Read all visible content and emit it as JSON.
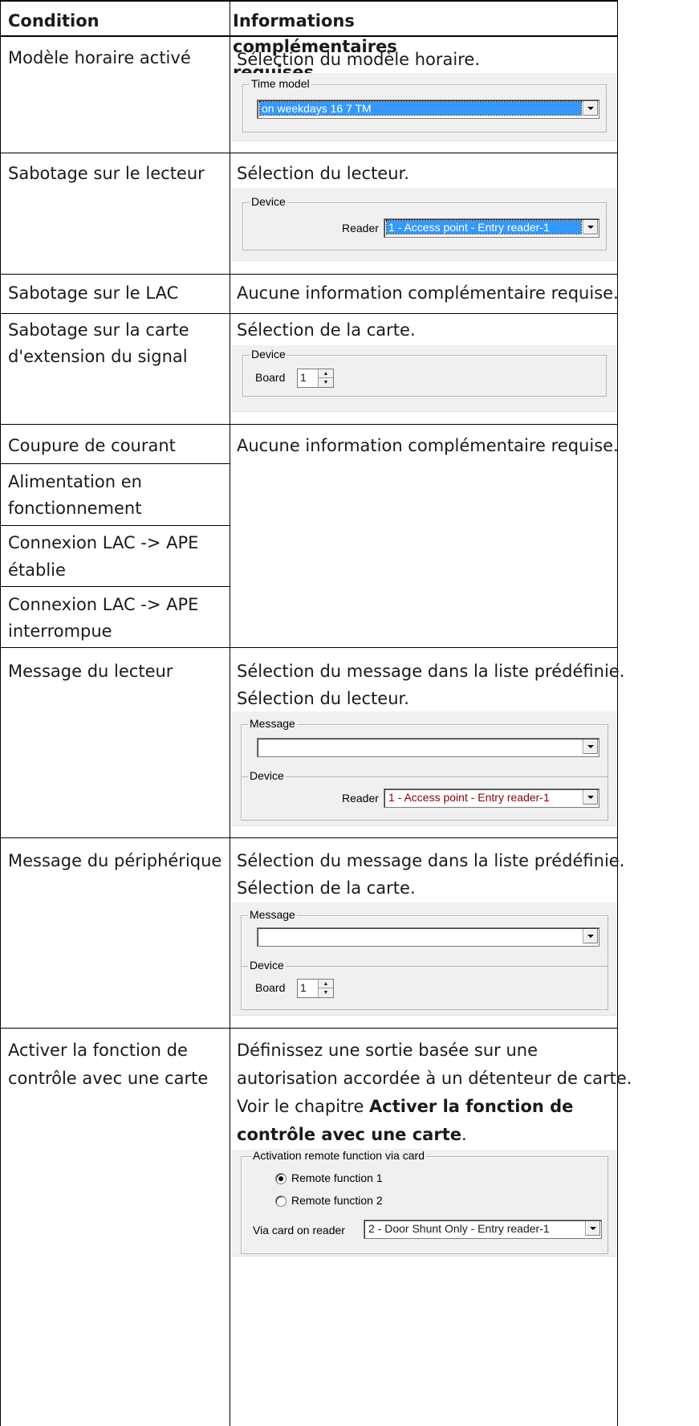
{
  "header": {
    "col1": "Condition",
    "col2": "Informations complémentaires requises"
  },
  "rows": [
    {
      "condition": "Modèle horaire activé",
      "info": "Sélection du modèle horaire."
    },
    {
      "condition": "Sabotage sur le lecteur",
      "info": "Sélection du lecteur."
    },
    {
      "condition": "Sabotage sur le LAC",
      "info": "Aucune information complémentaire requise."
    },
    {
      "condition_l1": "Sabotage sur la carte",
      "condition_l2": "d'extension du signal",
      "info": "Sélection de la carte."
    },
    {
      "condition": "Coupure de courant",
      "info": "Aucune information complémentaire requise."
    },
    {
      "condition_l1": "Alimentation en",
      "condition_l2": "fonctionnement"
    },
    {
      "condition_l1": "Connexion LAC -> APE",
      "condition_l2": "établie"
    },
    {
      "condition_l1": "Connexion LAC -> APE",
      "condition_l2": "interrompue"
    },
    {
      "condition": "Message du lecteur",
      "info_l1": "Sélection du message dans la liste prédéfinie.",
      "info_l2": "Sélection du lecteur."
    },
    {
      "condition": "Message du périphérique",
      "info_l1": "Sélection du message dans la liste prédéfinie.",
      "info_l2": "Sélection de la carte."
    },
    {
      "condition_l1": "Activer la fonction de",
      "condition_l2": "contrôle avec une carte",
      "info_l1": "Définissez une sortie basée sur une",
      "info_l2": "autorisation accordée à un détenteur de carte.",
      "info_l3_pre": "Voir le chapitre ",
      "info_l3_bold": "Activer la fonction de",
      "info_l4_bold": "contrôle avec une carte",
      "info_l4_post": "."
    }
  ],
  "dialogs": {
    "time_model": {
      "legend": "Time model",
      "value": "on weekdays 16 7 TM"
    },
    "reader_tamper": {
      "legend": "Device",
      "label": "Reader",
      "value": "1 - Access point - Entry reader-1"
    },
    "board_tamper": {
      "legend": "Device",
      "label": "Board",
      "value": "1"
    },
    "reader_message": {
      "message_legend": "Message",
      "message_value": "",
      "device_legend": "Device",
      "label": "Reader",
      "value": "1 - Access point - Entry reader-1"
    },
    "device_message": {
      "message_legend": "Message",
      "message_value": "",
      "device_legend": "Device",
      "label": "Board",
      "value": "1"
    },
    "remote": {
      "legend": "Activation remote function via card",
      "radio1": "Remote function  1",
      "radio2": "Remote function 2",
      "label": "Via card on reader",
      "value": "2 - Door Shunt Only - Entry reader-1"
    }
  }
}
